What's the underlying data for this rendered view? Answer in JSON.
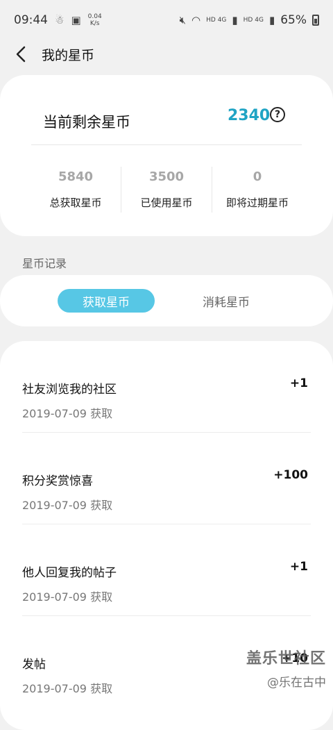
{
  "status_bar": {
    "time": "09:44",
    "net_speed_value": "0.04",
    "net_speed_unit": "K/s",
    "sim1": "HD",
    "sim1_net": "4G",
    "sim2": "HD",
    "sim2_net": "4G",
    "battery_text": "65%"
  },
  "header": {
    "title": "我的星币"
  },
  "summary": {
    "current_label": "当前剩余星币",
    "current_value": "2340",
    "help_symbol": "?",
    "stats": [
      {
        "value": "5840",
        "label": "总获取星币"
      },
      {
        "value": "3500",
        "label": "已使用星币"
      },
      {
        "value": "0",
        "label": "即将过期星币"
      }
    ]
  },
  "records_section": {
    "title": "星币记录",
    "tabs": [
      {
        "label": "获取星币",
        "active": true
      },
      {
        "label": "消耗星币",
        "active": false
      }
    ],
    "items": [
      {
        "title": "社友浏览我的社区",
        "date": "2019-07-09 获取",
        "amount": "+1"
      },
      {
        "title": "积分奖赏惊喜",
        "date": "2019-07-09 获取",
        "amount": "+100"
      },
      {
        "title": "他人回复我的帖子",
        "date": "2019-07-09 获取",
        "amount": "+1"
      },
      {
        "title": "发帖",
        "date": "2019-07-09 获取",
        "amount": "+10"
      }
    ]
  },
  "watermark": {
    "main": "盖乐世社区",
    "sub": "@乐在古中"
  },
  "colors": {
    "accent": "#20a4c4",
    "tab_active_bg": "#57c7e5",
    "page_bg": "#f1f1f1"
  }
}
